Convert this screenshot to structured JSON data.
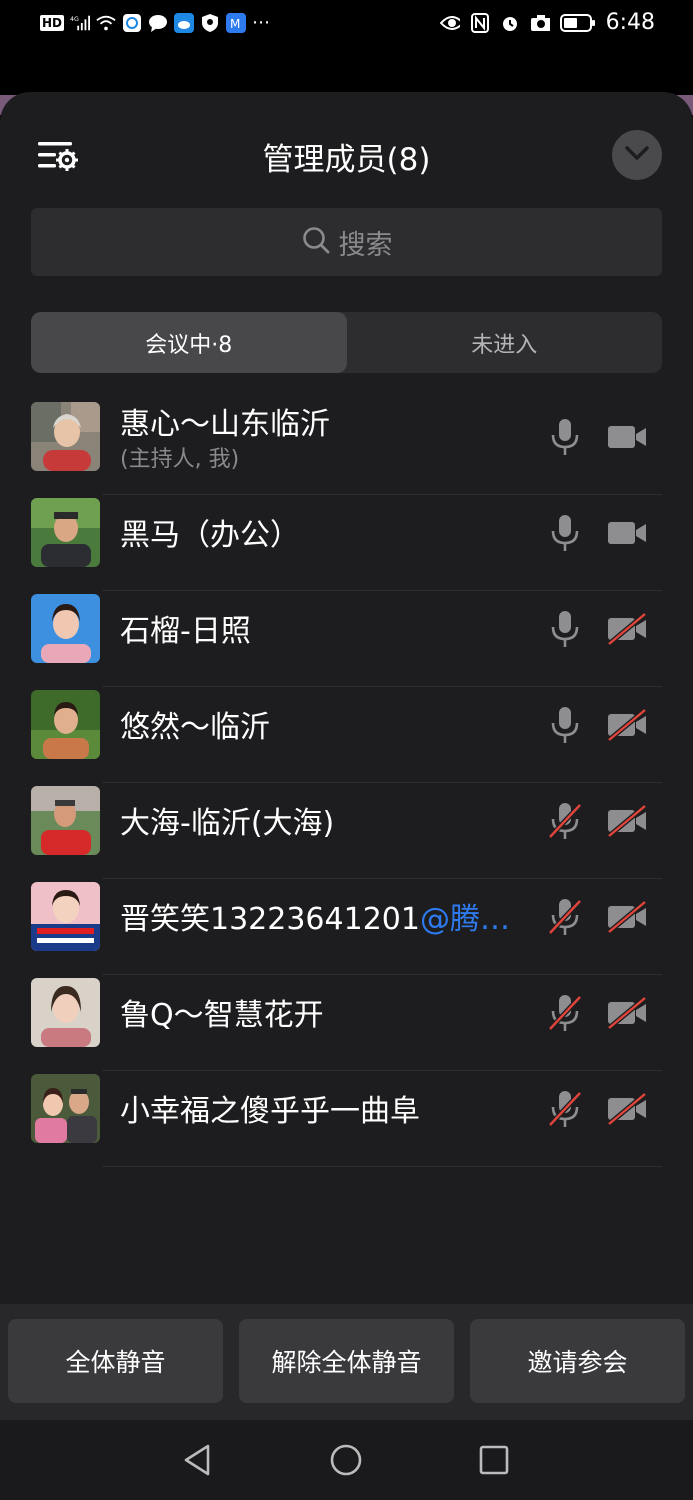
{
  "status_bar": {
    "time": "6:48",
    "network": "4G",
    "hd_label": "HD"
  },
  "header": {
    "title": "管理成员(8)"
  },
  "search": {
    "placeholder": "搜索"
  },
  "tabs": [
    {
      "label": "会议中·8",
      "active": true
    },
    {
      "label": "未进入",
      "active": false
    }
  ],
  "members": [
    {
      "name": "惠心～山东临沂",
      "tag": "",
      "sub": "(主持人, 我)",
      "mic_on": true,
      "cam_on": true
    },
    {
      "name": "黑马（办公）",
      "tag": "",
      "sub": "",
      "mic_on": true,
      "cam_on": true
    },
    {
      "name": "石榴-日照",
      "tag": "",
      "sub": "",
      "mic_on": true,
      "cam_on": false
    },
    {
      "name": "悠然～临沂",
      "tag": "",
      "sub": "",
      "mic_on": true,
      "cam_on": false
    },
    {
      "name": "大海-临沂(大海)",
      "tag": "",
      "sub": "",
      "mic_on": false,
      "cam_on": false
    },
    {
      "name": "晋笑笑13223641201",
      "tag": "@腾…",
      "sub": "",
      "mic_on": false,
      "cam_on": false
    },
    {
      "name": "鲁Q～智慧花开",
      "tag": "",
      "sub": "",
      "mic_on": false,
      "cam_on": false
    },
    {
      "name": "小幸福之傻乎乎一曲阜",
      "tag": "",
      "sub": "",
      "mic_on": false,
      "cam_on": false
    }
  ],
  "actions": {
    "mute_all": "全体静音",
    "unmute_all": "解除全体静音",
    "invite": "邀请参会"
  },
  "colors": {
    "sheet_bg": "#1d1d1f",
    "accent_blue": "#2e7bf0",
    "muted_red": "#e0443a",
    "icon_gray": "#8e8e91"
  }
}
